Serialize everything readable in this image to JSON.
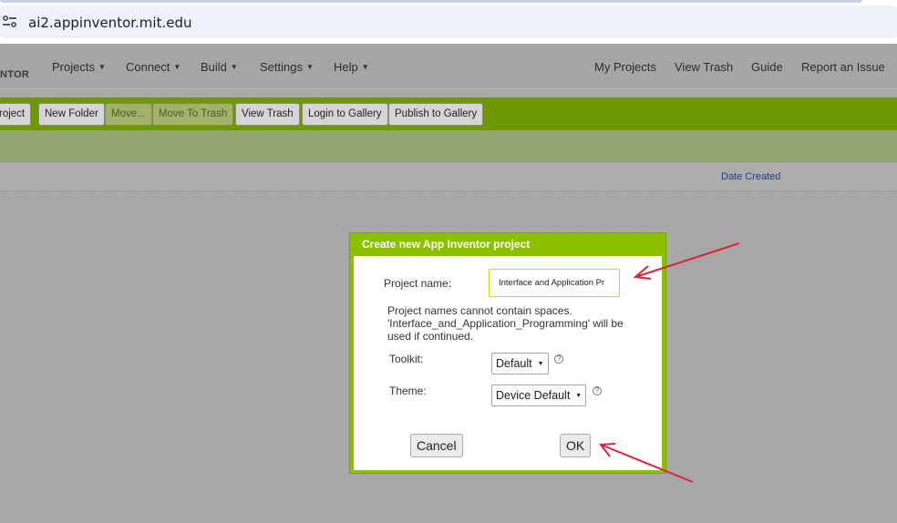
{
  "browser": {
    "url": "ai2.appinventor.mit.edu"
  },
  "nav": {
    "brand": "NTOR",
    "menus": [
      "Projects",
      "Connect",
      "Build",
      "Settings",
      "Help"
    ],
    "links": [
      "My Projects",
      "View Trash",
      "Guide",
      "Report an Issue"
    ]
  },
  "toolbar": {
    "new_project": "roject",
    "new_folder": "New Folder",
    "move": "Move...",
    "move_to_trash": "Move To Trash",
    "view_trash": "View Trash",
    "login_gallery": "Login to Gallery",
    "publish_gallery": "Publish to Gallery"
  },
  "table": {
    "date_created": "Date Created"
  },
  "dialog": {
    "title": "Create new App Inventor project",
    "project_name_label": "Project name:",
    "project_name_value": "Interface and Application Pr",
    "message_line1": "Project names cannot contain spaces.",
    "message_line2": "'Interface_and_Application_Programming' will be",
    "message_line3": "used if continued.",
    "toolkit_label": "Toolkit:",
    "toolkit_value": "Default",
    "theme_label": "Theme:",
    "theme_value": "Device Default",
    "help_glyph": "?",
    "cancel": "Cancel",
    "ok": "OK"
  },
  "colors": {
    "toolbar_green": "#6e9800",
    "dialog_green": "#8cc000",
    "annotation_red": "#e0213a"
  },
  "icons": [
    "site-settings-icon",
    "dropdown-caret-icon",
    "help-icon",
    "arrow-annotation-icon"
  ]
}
